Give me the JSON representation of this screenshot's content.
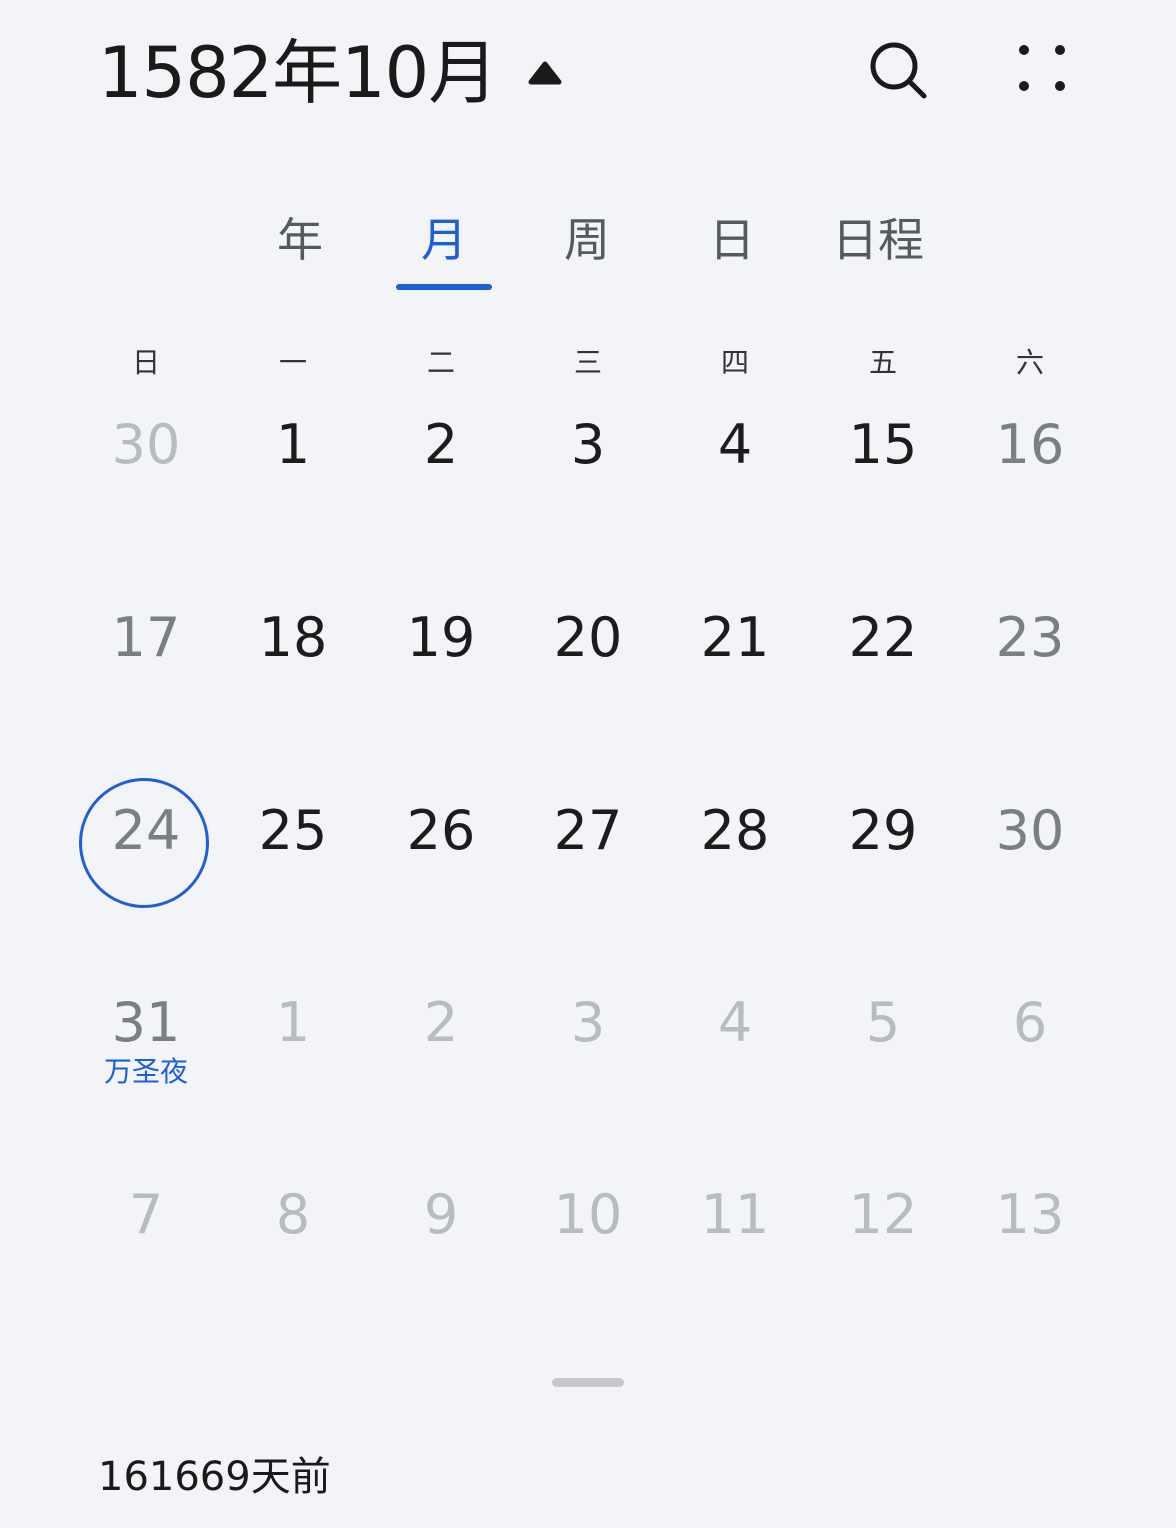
{
  "header": {
    "title": "1582年10月",
    "caret_icon": "caret-up-icon",
    "search_icon": "search-icon",
    "more_icon": "more-dots-icon"
  },
  "tabs": [
    {
      "label": "年",
      "active": false
    },
    {
      "label": "月",
      "active": true
    },
    {
      "label": "周",
      "active": false
    },
    {
      "label": "日",
      "active": false
    },
    {
      "label": "日程",
      "active": false
    }
  ],
  "weekdays": [
    "日",
    "一",
    "二",
    "三",
    "四",
    "五",
    "六"
  ],
  "weeks": [
    [
      {
        "d": "30",
        "s": "other"
      },
      {
        "d": "1",
        "s": "cur"
      },
      {
        "d": "2",
        "s": "cur"
      },
      {
        "d": "3",
        "s": "cur"
      },
      {
        "d": "4",
        "s": "cur"
      },
      {
        "d": "15",
        "s": "cur"
      },
      {
        "d": "16",
        "s": "weekend"
      }
    ],
    [
      {
        "d": "17",
        "s": "weekend"
      },
      {
        "d": "18",
        "s": "cur"
      },
      {
        "d": "19",
        "s": "cur"
      },
      {
        "d": "20",
        "s": "cur"
      },
      {
        "d": "21",
        "s": "cur"
      },
      {
        "d": "22",
        "s": "cur"
      },
      {
        "d": "23",
        "s": "weekend"
      }
    ],
    [
      {
        "d": "24",
        "s": "weekend",
        "today": true
      },
      {
        "d": "25",
        "s": "cur"
      },
      {
        "d": "26",
        "s": "cur"
      },
      {
        "d": "27",
        "s": "cur"
      },
      {
        "d": "28",
        "s": "cur"
      },
      {
        "d": "29",
        "s": "cur"
      },
      {
        "d": "30",
        "s": "weekend"
      }
    ],
    [
      {
        "d": "31",
        "s": "weekend",
        "holiday": "万圣夜"
      },
      {
        "d": "1",
        "s": "other"
      },
      {
        "d": "2",
        "s": "other"
      },
      {
        "d": "3",
        "s": "other"
      },
      {
        "d": "4",
        "s": "other"
      },
      {
        "d": "5",
        "s": "other"
      },
      {
        "d": "6",
        "s": "other"
      }
    ],
    [
      {
        "d": "7",
        "s": "other"
      },
      {
        "d": "8",
        "s": "other"
      },
      {
        "d": "9",
        "s": "other"
      },
      {
        "d": "10",
        "s": "other"
      },
      {
        "d": "11",
        "s": "other"
      },
      {
        "d": "12",
        "s": "other"
      },
      {
        "d": "13",
        "s": "other"
      }
    ]
  ],
  "footer": {
    "days_ago": "161669天前"
  },
  "colors": {
    "accent": "#1f5fd6",
    "background": "#f2f4f7"
  }
}
